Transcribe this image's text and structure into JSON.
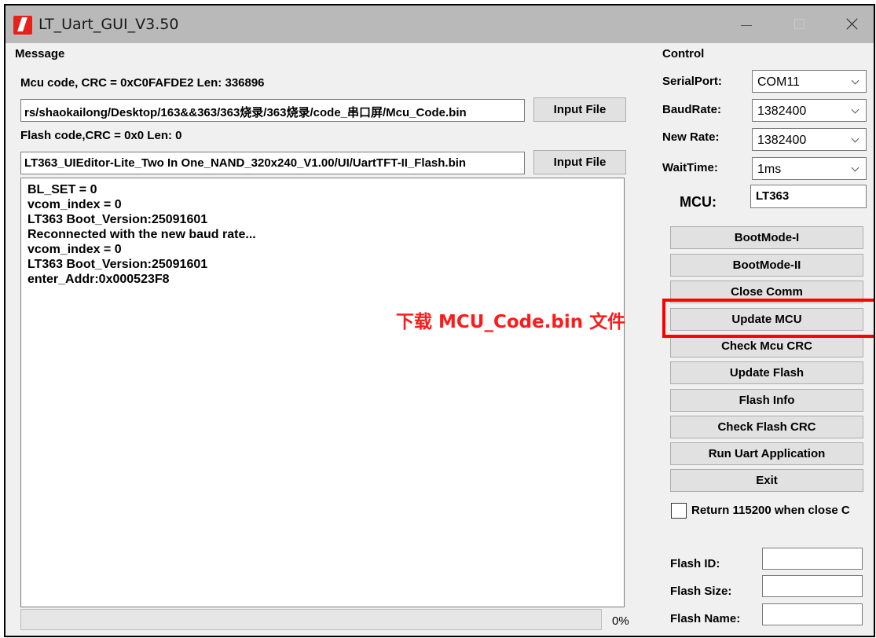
{
  "window": {
    "title": "LT_Uart_GUI_V3.50"
  },
  "message": {
    "group_label": "Message",
    "mcu_code_info": "Mcu code, CRC = 0xC0FAFDE2 Len: 336896",
    "mcu_file_path": "rs/shaokailong/Desktop/163&&363/363烧录/363烧录/code_串口屏/Mcu_Code.bin",
    "mcu_input_button": "Input File",
    "flash_code_info": "Flash code,CRC = 0x0  Len: 0",
    "flash_file_path": "LT363_UIEditor-Lite_Two In One_NAND_320x240_V1.00/UI/UartTFT-II_Flash.bin",
    "flash_input_button": "Input File",
    "log_lines": [
      "BL_SET = 0",
      "vcom_index = 0",
      "LT363 Boot_Version:25091601",
      "Reconnected with the new baud rate...",
      "vcom_index = 0",
      "LT363 Boot_Version:25091601",
      "enter_Addr:0x000523F8"
    ],
    "progress_fraction": 0,
    "progress_text": "0%"
  },
  "control": {
    "group_label": "Control",
    "serial_port_label": "SerialPort:",
    "serial_port_value": "COM11",
    "baud_rate_label": "BaudRate:",
    "baud_rate_value": "1382400",
    "new_rate_label": "New Rate:",
    "new_rate_value": "1382400",
    "wait_time_label": "WaitTime:",
    "wait_time_value": "1ms",
    "mcu_label": "MCU:",
    "mcu_value": "LT363",
    "buttons": [
      "BootMode-I",
      "BootMode-II",
      "Close Comm",
      "Update MCU",
      "Check Mcu CRC",
      "Update Flash",
      "Flash Info",
      "Check Flash CRC",
      "Run Uart Application",
      "Exit"
    ],
    "return_checkbox_label": "Return 115200 when close C",
    "return_checkbox_checked": false,
    "flash_id_label": "Flash ID:",
    "flash_id_value": "",
    "flash_size_label": "Flash Size:",
    "flash_size_value": "",
    "flash_name_label": "Flash Name:",
    "flash_name_value": ""
  },
  "annotation": {
    "text": "下载 MCU_Code.bin 文件",
    "color": "#ff0000"
  },
  "colors": {
    "titlebar": "#b9b9b9",
    "window_bg": "#f0f0f0",
    "button_bg": "#e1e1e1",
    "accent_icon": "#e8201c"
  }
}
